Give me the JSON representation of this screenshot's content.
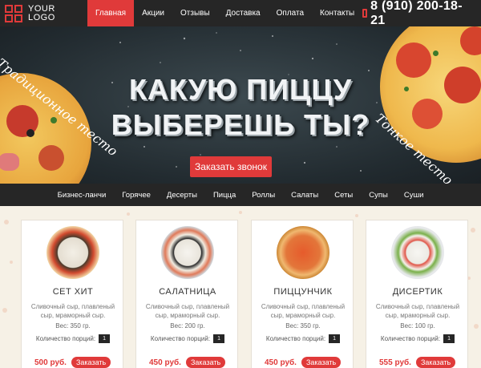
{
  "header": {
    "logo_line1": "YOUR",
    "logo_line2": "LOGO",
    "nav": [
      "Главная",
      "Акции",
      "Отзывы",
      "Доставка",
      "Оплата",
      "Контакты"
    ],
    "phone": "8 (910) 200-18-21",
    "accent": "#e03a3a"
  },
  "hero": {
    "title_line1": "КАКУЮ ПИЦЦУ",
    "title_line2": "ВЫБЕРЕШЬ ТЫ?",
    "left_arc": "Традиционное тесто",
    "right_arc": "Тонкое тесто",
    "cta": "Заказать звонок"
  },
  "categories": [
    "Бизнес-ланчи",
    "Горячее",
    "Десерты",
    "Пицца",
    "Роллы",
    "Салаты",
    "Сеты",
    "Супы",
    "Суши"
  ],
  "products": [
    {
      "title": "СЕТ ХИТ",
      "desc": "Сливочный сыр, плавленый сыр, мраморный сыр.",
      "weight": "Вес: 350 гр.",
      "qty_label": "Количество порций:",
      "qty": "1",
      "price": "500 руб.",
      "order": "Заказать",
      "image": "sushi-set-plate"
    },
    {
      "title": "САЛАТНИЦА",
      "desc": "Сливочный сыр, плавленый сыр, мраморный сыр.",
      "weight": "Вес: 200 гр.",
      "qty_label": "Количество порций:",
      "qty": "1",
      "price": "450 руб.",
      "order": "Заказать",
      "image": "rolls-plate"
    },
    {
      "title": "ПИЦЦУНЧИК",
      "desc": "Сливочный сыр, плавленый сыр, мраморный сыр.",
      "weight": "Вес: 350 гр.",
      "qty_label": "Количество порций:",
      "qty": "1",
      "price": "450 руб.",
      "order": "Заказать",
      "image": "pizza"
    },
    {
      "title": "ДИСЕРТИК",
      "desc": "Сливочный сыр, плавленый сыр, мраморный сыр.",
      "weight": "Вес: 100 гр.",
      "qty_label": "Количество порций:",
      "qty": "1",
      "price": "555 руб.",
      "order": "Заказать",
      "image": "sushi-plate"
    }
  ]
}
